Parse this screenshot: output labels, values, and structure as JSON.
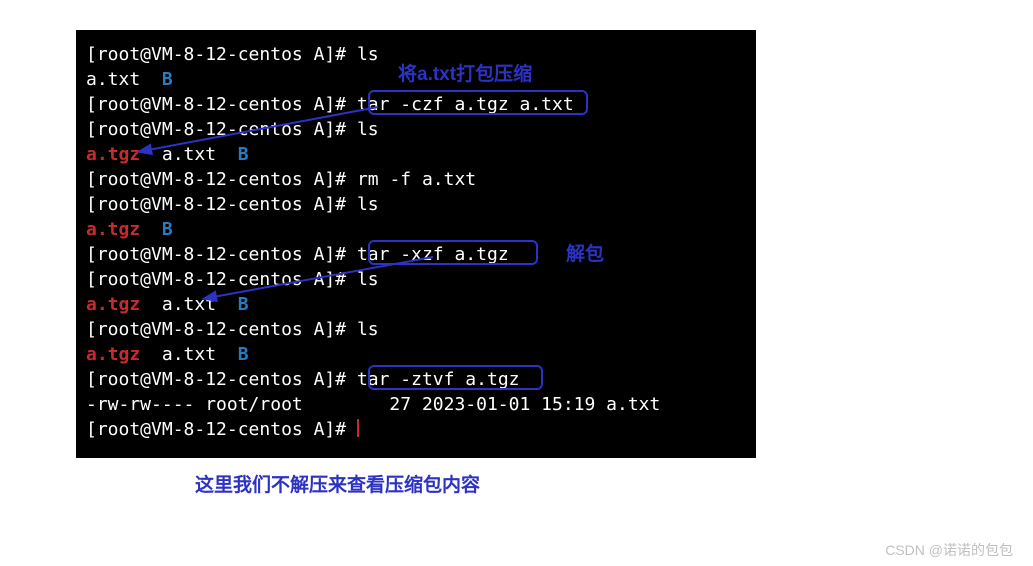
{
  "prompt": "[root@VM-8-12-centos A]# ",
  "lines": {
    "l1_cmd": "ls",
    "l2_a": "a.txt  ",
    "l2_b": "B",
    "l3_cmd": "tar -czf a.tgz a.txt",
    "l4_cmd": "ls",
    "l5_tgz": "a.tgz",
    "l5_rest": "  a.txt  ",
    "l5_b": "B",
    "l6_cmd": "rm -f a.txt",
    "l7_cmd": "ls",
    "l8_tgz": "a.tgz",
    "l8_sp": "  ",
    "l8_b": "B",
    "l9_cmd": "tar -xzf a.tgz",
    "l10_cmd": "ls",
    "l11_tgz": "a.tgz",
    "l11_rest": "  a.txt  ",
    "l11_b": "B",
    "l12_cmd": "ls",
    "l13_tgz": "a.tgz",
    "l13_rest": "  a.txt  ",
    "l13_b": "B",
    "l14_cmd": "tar -ztvf a.tgz",
    "l15_out": "-rw-rw---- root/root        27 2023-01-01 15:19 a.txt",
    "l16_cmd": ""
  },
  "annotations": {
    "label1": "将a.txt打包压缩",
    "label2": "解包",
    "caption": "这里我们不解压来查看压缩包内容"
  },
  "watermark": "CSDN @诺诺的包包"
}
